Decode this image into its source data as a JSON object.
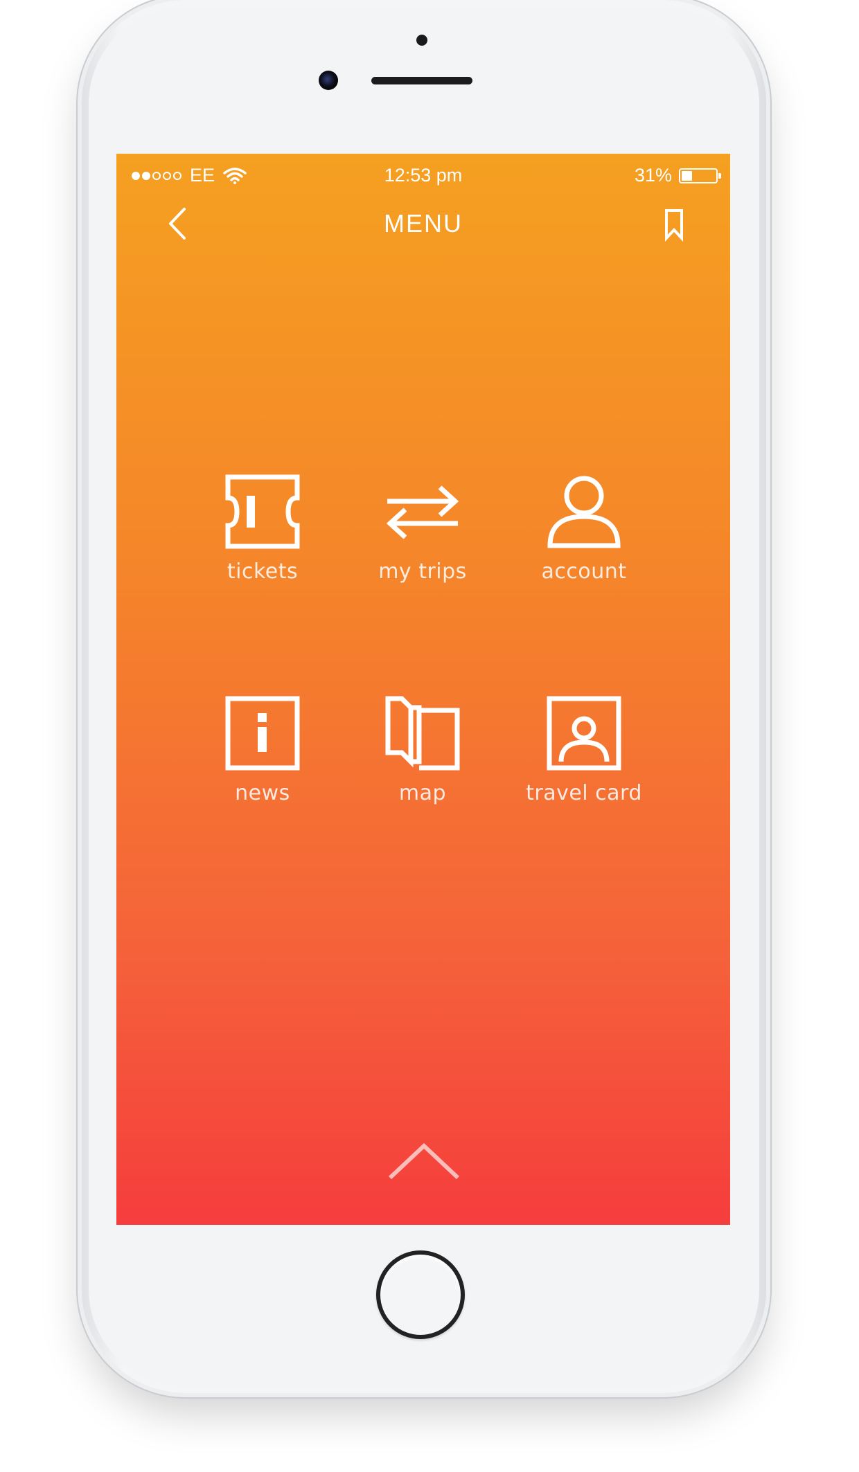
{
  "status_bar": {
    "signal_dots_filled": 2,
    "signal_dots_total": 5,
    "carrier": "EE",
    "time": "12:53 pm",
    "battery_percent": "31%",
    "battery_level": 0.31
  },
  "nav": {
    "title": "MENU",
    "back_icon": "chevron-left-icon",
    "bookmark_icon": "bookmark-icon"
  },
  "menu": {
    "items": [
      {
        "label": "tickets",
        "icon": "ticket-icon"
      },
      {
        "label": "my trips",
        "icon": "swap-arrows-icon"
      },
      {
        "label": "account",
        "icon": "user-icon"
      },
      {
        "label": "news",
        "icon": "info-icon"
      },
      {
        "label": "map",
        "icon": "map-icon"
      },
      {
        "label": "travel card",
        "icon": "id-card-icon"
      }
    ]
  },
  "footer": {
    "icon": "chevron-up-icon"
  },
  "colors": {
    "gradient_top": "#f5a021",
    "gradient_bottom": "#f53d3d",
    "foreground": "#ffffff"
  }
}
